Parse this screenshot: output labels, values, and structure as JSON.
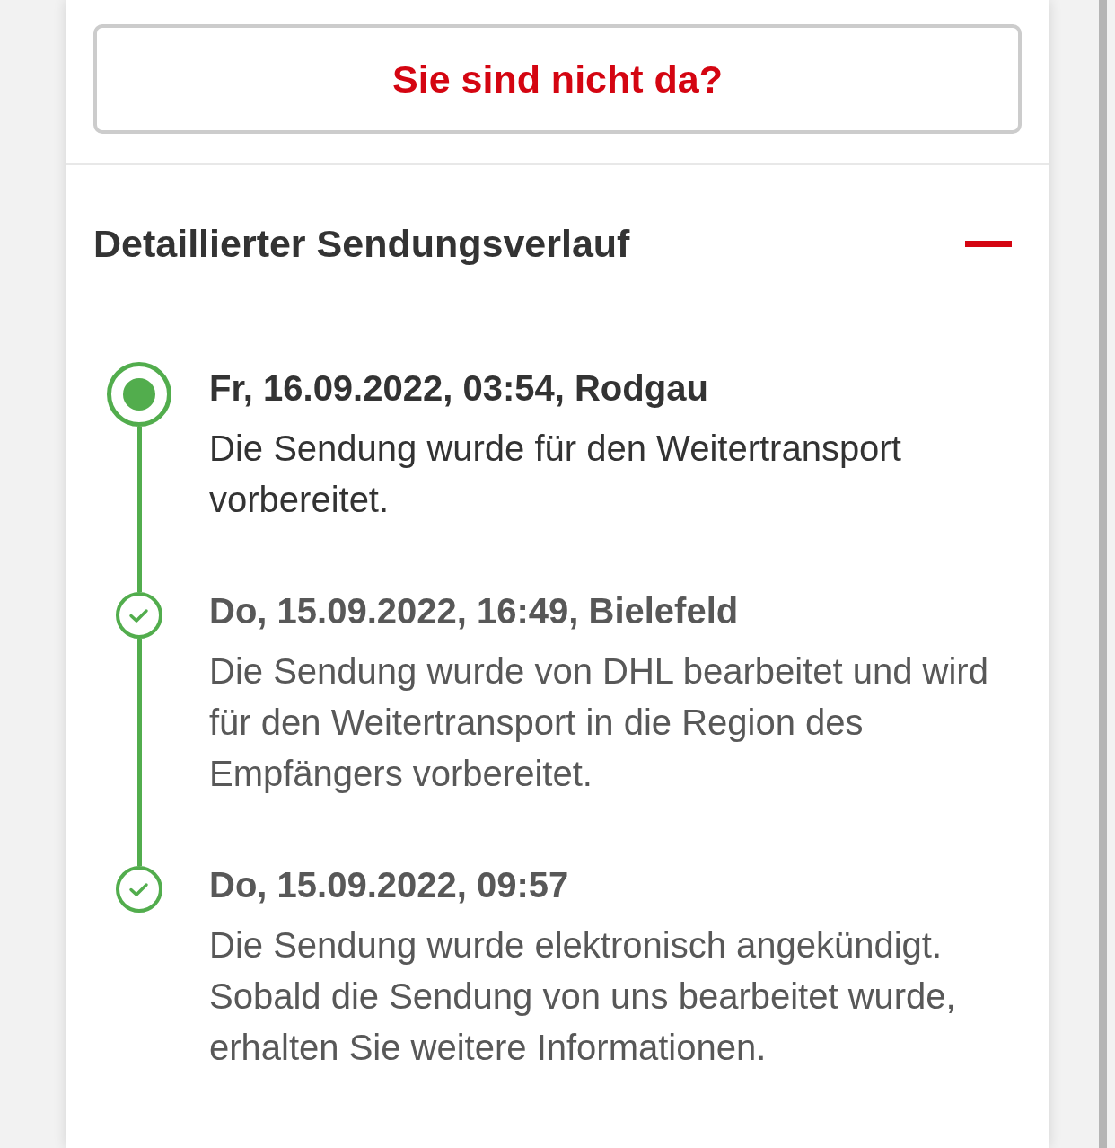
{
  "absence_button": {
    "label": "Sie sind nicht da?"
  },
  "history": {
    "title": "Detaillierter Sendungsverlauf",
    "expanded": true,
    "events": [
      {
        "kind": "current",
        "date": "Fr, 16.09.2022, 03:54, Rodgau",
        "text": "Die Sendung wurde für den Weitertransport vorbereitet."
      },
      {
        "kind": "done",
        "date": "Do, 15.09.2022, 16:49, Bielefeld",
        "text": "Die Sendung wurde von DHL bearbeitet und wird für den Weitertransport in die Region des Empfängers vorbereitet."
      },
      {
        "kind": "done",
        "date": "Do, 15.09.2022, 09:57",
        "text": "Die Sendung wurde elektronisch angekündigt. Sobald die Sendung von uns bearbeitet wurde, erhalten Sie weitere Informationen."
      }
    ]
  }
}
